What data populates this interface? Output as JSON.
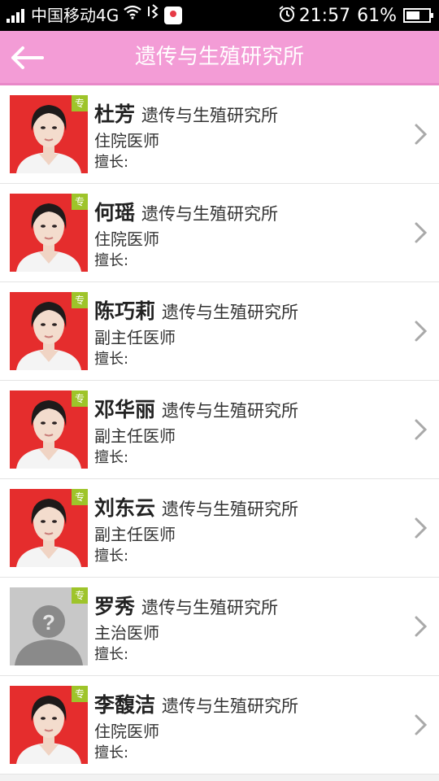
{
  "status_bar": {
    "carrier": "中国移动4G",
    "time": "21:57",
    "battery": "61%",
    "battery_level": 0.61,
    "icons": [
      "signal-icon",
      "wifi-icon",
      "vibrate-icon",
      "map-app-icon",
      "alarm-icon",
      "battery-icon"
    ]
  },
  "header": {
    "title": "遗传与生殖研究所",
    "back_icon": "arrow-left-icon"
  },
  "badge_label": "专",
  "specialty_label": "擅长:",
  "colors": {
    "header_bg": "#f39cd6",
    "badge_bg": "#9ec42a",
    "photo_bg": "#e52d2d",
    "placeholder_bg": "#c8c8c8"
  },
  "doctors": [
    {
      "name": "杜芳",
      "department": "遗传与生殖研究所",
      "title": "住院医师",
      "photo": "portrait"
    },
    {
      "name": "何瑶",
      "department": "遗传与生殖研究所",
      "title": "住院医师",
      "photo": "portrait"
    },
    {
      "name": "陈巧莉",
      "department": "遗传与生殖研究所",
      "title": "副主任医师",
      "photo": "portrait"
    },
    {
      "name": "邓华丽",
      "department": "遗传与生殖研究所",
      "title": "副主任医师",
      "photo": "portrait"
    },
    {
      "name": "刘东云",
      "department": "遗传与生殖研究所",
      "title": "副主任医师",
      "photo": "portrait"
    },
    {
      "name": "罗秀",
      "department": "遗传与生殖研究所",
      "title": "主治医师",
      "photo": "placeholder"
    },
    {
      "name": "李馥洁",
      "department": "遗传与生殖研究所",
      "title": "住院医师",
      "photo": "portrait"
    }
  ]
}
